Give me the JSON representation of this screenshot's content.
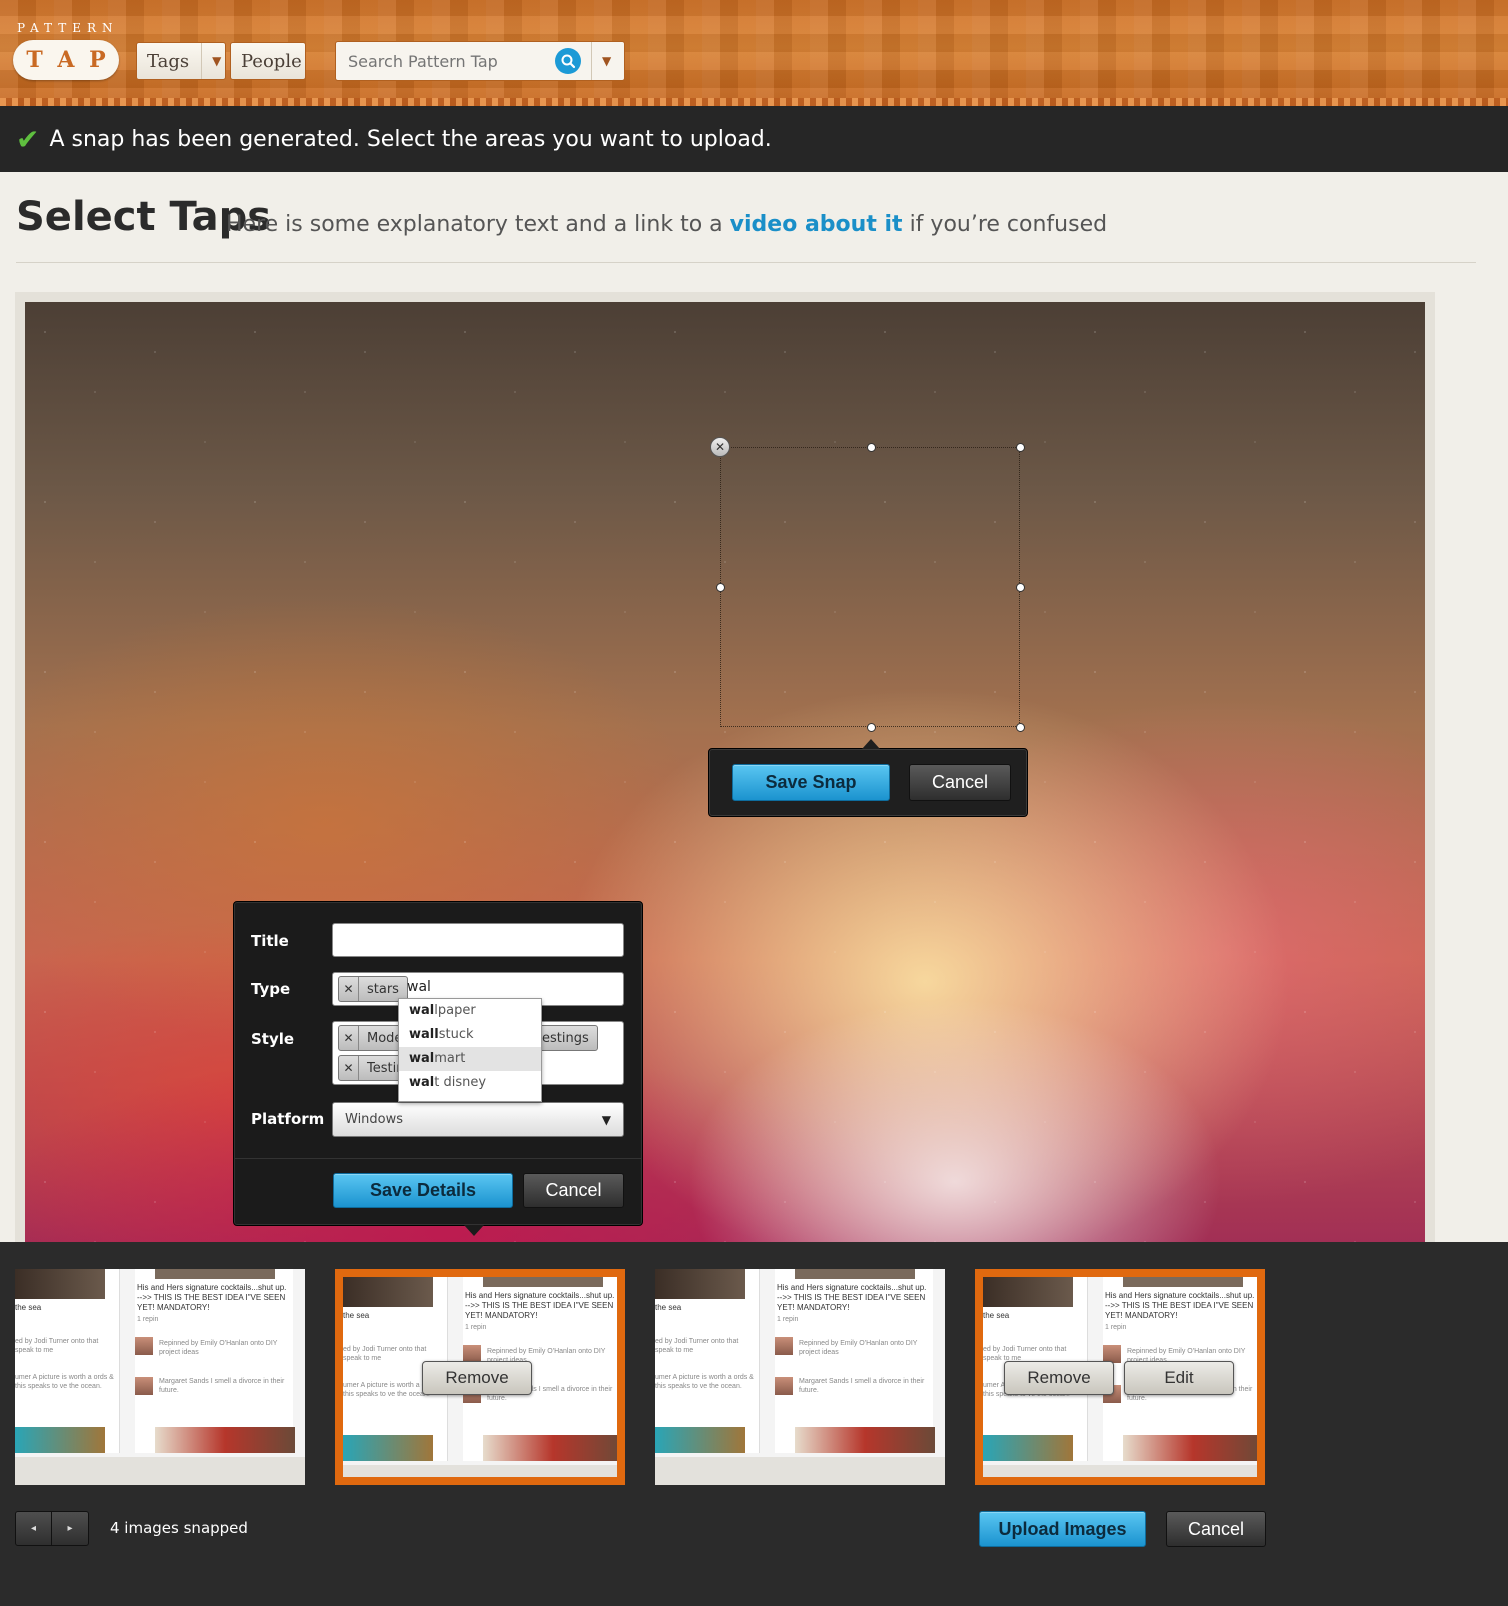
{
  "header": {
    "logo_top": "PATTERN",
    "logo_letters": [
      "T",
      "A",
      "P"
    ],
    "nav": {
      "tags_label": "Tags",
      "people_label": "People"
    },
    "search": {
      "placeholder": "Search Pattern Tap"
    }
  },
  "notice": {
    "text": "A snap has been generated. Select the areas you want to upload."
  },
  "page": {
    "title": "Select Taps",
    "description_before": "Here is some explanatory text and a link to a ",
    "description_link": "video about it",
    "description_after": " if you’re confused"
  },
  "snap_toolbar": {
    "save_label": "Save Snap",
    "cancel_label": "Cancel"
  },
  "details_form": {
    "title_label": "Title",
    "title_value": "",
    "type_label": "Type",
    "type_tags": [
      "stars"
    ],
    "type_typed": "wal",
    "style_label": "Style",
    "style_tags": [
      "Mode",
      "estings",
      "Testin"
    ],
    "platform_label": "Platform",
    "platform_value": "Windows",
    "save_label": "Save Details",
    "cancel_label": "Cancel",
    "autocomplete": [
      {
        "match": "wal",
        "rest": "lpaper"
      },
      {
        "match": "wall",
        "rest": "stuck"
      },
      {
        "match": "wal",
        "rest": "mart"
      },
      {
        "match": "wal",
        "rest": "t disney"
      }
    ],
    "autocomplete_highlighted_index": 2
  },
  "tray": {
    "thumb_text": {
      "caption_left": "the sea",
      "post_title": "His and Hers signature cocktails...shut up. -->> THIS IS THE BEST IDEA I\"VE SEEN YET! MANDATORY!",
      "repin": "1 repin",
      "repinned_by": "Repinned by Emily O'Hanlan onto DIY project ideas",
      "left_pinned": "ed by Jodi Turner onto that speak to me",
      "left_quote": "umer A picture is worth a ords & this speaks to ve the ocean.",
      "margaret": "Margaret Sands I smell a divorce in their future."
    },
    "remove_label": "Remove",
    "edit_label": "Edit",
    "count_text": "4 images snapped",
    "upload_label": "Upload Images",
    "cancel_label": "Cancel",
    "prev_icon": "◂",
    "next_icon": "▸"
  },
  "colors": {
    "accent_blue": "#1b93cf",
    "header_orange": "#cf6f24",
    "selected_border": "#e0690f",
    "success_green": "#5fbf3f"
  }
}
